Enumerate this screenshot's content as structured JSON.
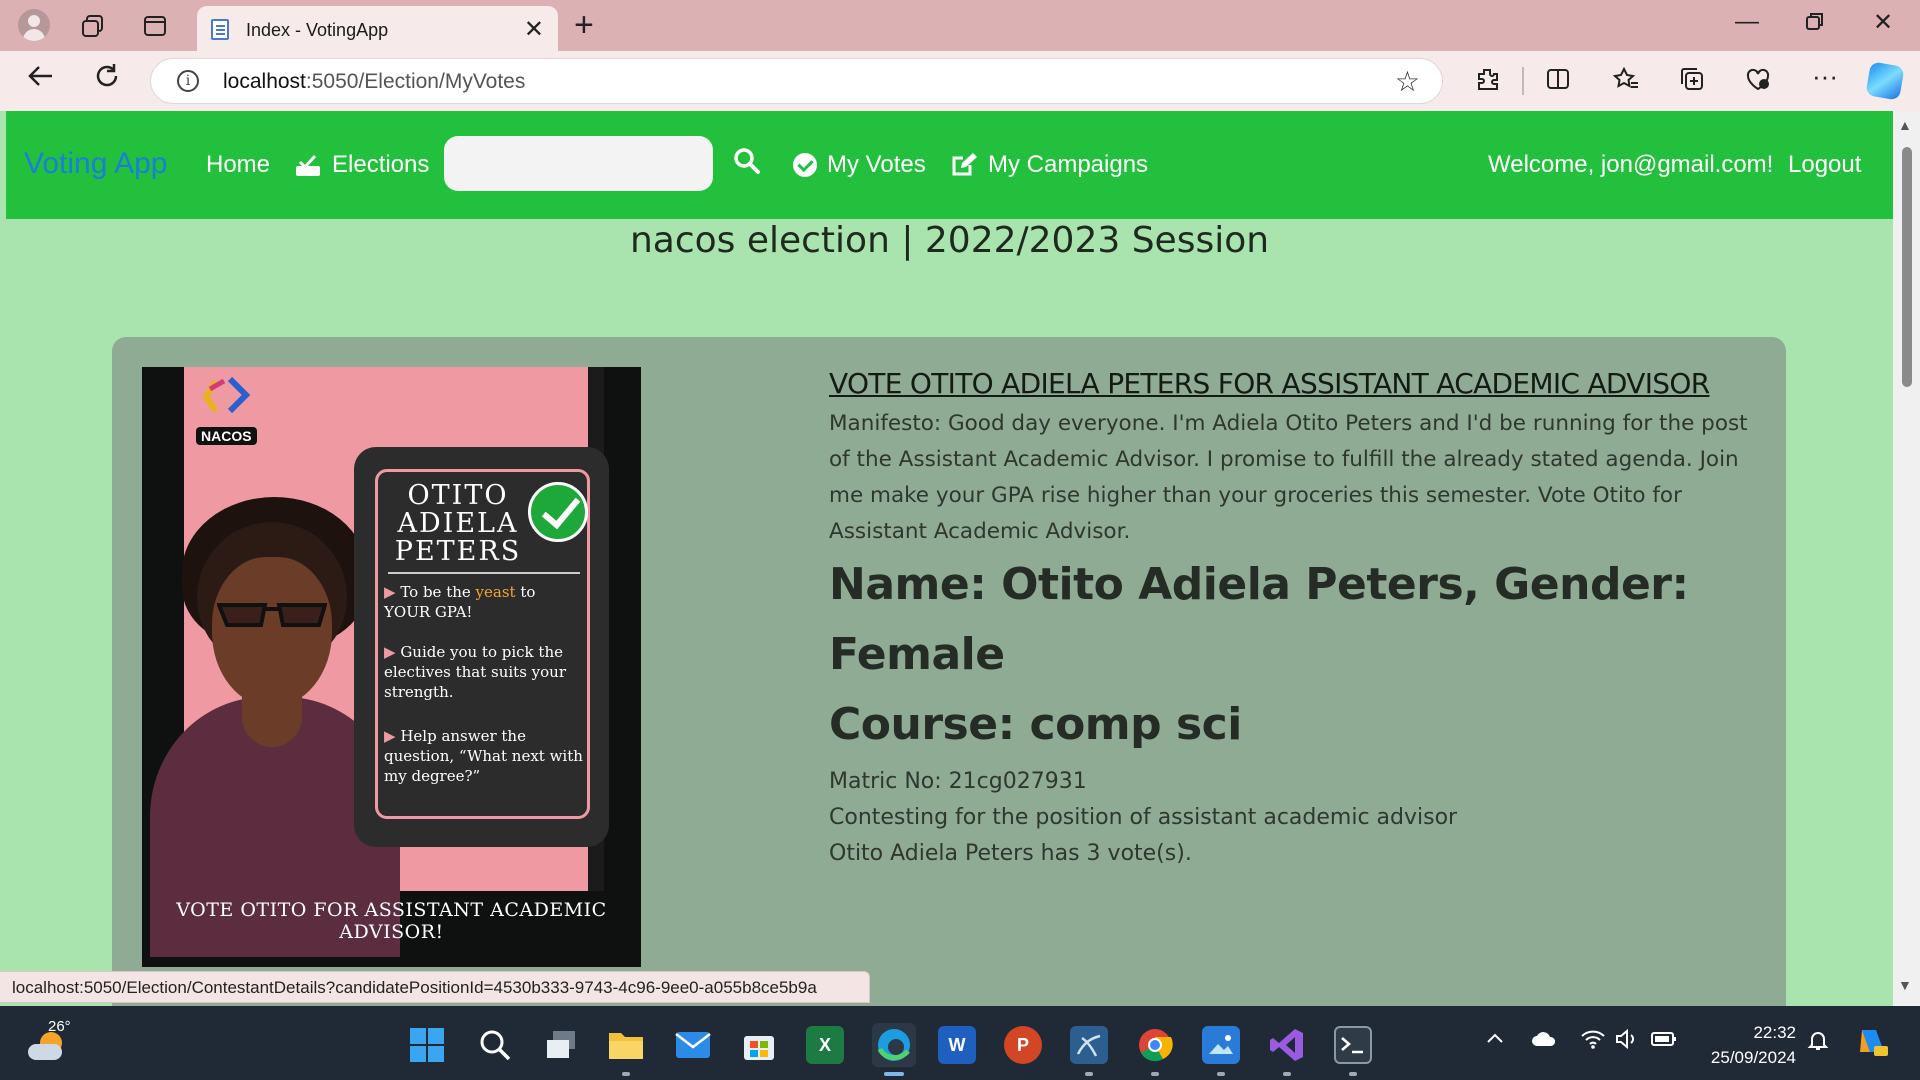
{
  "browser": {
    "tab_title": "Index - VotingApp",
    "url_host": "localhost",
    "url_path": ":5050/Election/MyVotes",
    "status_url": "localhost:5050/Election/ContestantDetails?candidatePositionId=4530b333-9743-4c96-9ee0-a055b8ce5b9a"
  },
  "navbar": {
    "brand": "Voting App",
    "home": "Home",
    "elections": "Elections",
    "search_placeholder": "",
    "my_votes": "My Votes",
    "my_campaigns": "My Campaigns",
    "welcome": "Welcome, jon@gmail.com!",
    "logout": "Logout",
    "bg_color": "#22c03c",
    "brand_color": "#1a7fdb"
  },
  "page": {
    "title": "nacos election | 2022/2023 Session"
  },
  "candidate": {
    "headline": "VOTE OTITO ADIELA PETERS FOR ASSISTANT ACADEMIC ADVISOR",
    "manifesto": "Manifesto: Good day everyone. I'm Adiela Otito Peters and I'd be running for the post of the Assistant Academic Advisor. I promise to fulfill the already stated agenda. Join me make your GPA rise higher than your groceries this semester. Vote Otito for Assistant Academic Advisor.",
    "name_gender": "Name: Otito Adiela Peters, Gender: Female",
    "course": "Course: comp sci",
    "matric": "Matric No: 21cg027931",
    "contesting": "Contesting for the position of assistant academic advisor",
    "votes": "Otito Adiela Peters has 3 vote(s)."
  },
  "poster": {
    "logo": "NACOS",
    "name_line1": "OTITO",
    "name_line2": "ADIELA",
    "name_line3": "PETERS",
    "bullet1_pre": "To be the ",
    "bullet1_yeast": "yeast",
    "bullet1_post": " to YOUR GPA!",
    "bullet2": "Guide you to pick the electives that suits your strength.",
    "bullet3": "Help answer the question, “What next with my degree?”",
    "footer": "VOTE OTITO FOR ASSISTANT ACADEMIC ADVISOR!"
  },
  "taskbar": {
    "temperature": "26°",
    "time": "22:32",
    "date": "25/09/2024"
  }
}
